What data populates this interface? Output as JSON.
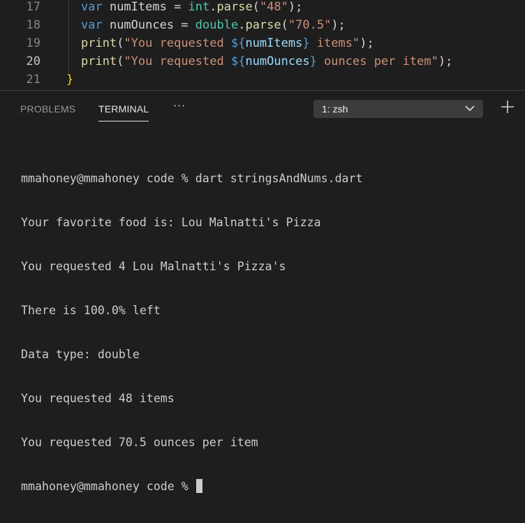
{
  "editor": {
    "lines": [
      {
        "num": "17",
        "tokens": [
          [
            "kw",
            "var"
          ],
          [
            "op",
            " numItems = "
          ],
          [
            "ty",
            "int"
          ],
          [
            "op",
            "."
          ],
          [
            "fn",
            "parse"
          ],
          [
            "op",
            "("
          ],
          [
            "str",
            "\"48\""
          ],
          [
            "op",
            ");"
          ]
        ]
      },
      {
        "num": "18",
        "tokens": [
          [
            "kw",
            "var"
          ],
          [
            "op",
            " numOunces = "
          ],
          [
            "ty",
            "double"
          ],
          [
            "op",
            "."
          ],
          [
            "fn",
            "parse"
          ],
          [
            "op",
            "("
          ],
          [
            "str",
            "\"70.5\""
          ],
          [
            "op",
            ");"
          ]
        ]
      },
      {
        "num": "19",
        "tokens": [
          [
            "fn",
            "print"
          ],
          [
            "op",
            "("
          ],
          [
            "str",
            "\"You requested "
          ],
          [
            "kw",
            "${"
          ],
          [
            "var",
            "numItems"
          ],
          [
            "kw",
            "}"
          ],
          [
            "str",
            " items\""
          ],
          [
            "op",
            ");"
          ]
        ]
      },
      {
        "num": "20",
        "tokens": [
          [
            "fn",
            "print"
          ],
          [
            "op",
            "("
          ],
          [
            "str",
            "\"You requested "
          ],
          [
            "kw",
            "${"
          ],
          [
            "var",
            "numOunces"
          ],
          [
            "kw",
            "}"
          ],
          [
            "str",
            " ounces per item\""
          ],
          [
            "op",
            ");"
          ]
        ]
      },
      {
        "num": "21",
        "tokens": [
          [
            "br",
            "}"
          ]
        ]
      }
    ],
    "current_line": "20"
  },
  "panel": {
    "tabs": [
      "PROBLEMS",
      "TERMINAL"
    ],
    "active_tab": "TERMINAL",
    "more_label": "···",
    "terminal_select": "1: zsh"
  },
  "terminal": {
    "lines": [
      "mmahoney@mmahoney code % dart stringsAndNums.dart",
      "Your favorite food is: Lou Malnatti's Pizza",
      "You requested 4 Lou Malnatti's Pizza's",
      "There is 100.0% left",
      "Data type: double",
      "You requested 48 items",
      "You requested 70.5 ounces per item"
    ],
    "prompt": "mmahoney@mmahoney code % "
  },
  "icons": {
    "more": "ellipsis-icon",
    "select": "chevron-down-icon",
    "new": "plus-icon"
  }
}
